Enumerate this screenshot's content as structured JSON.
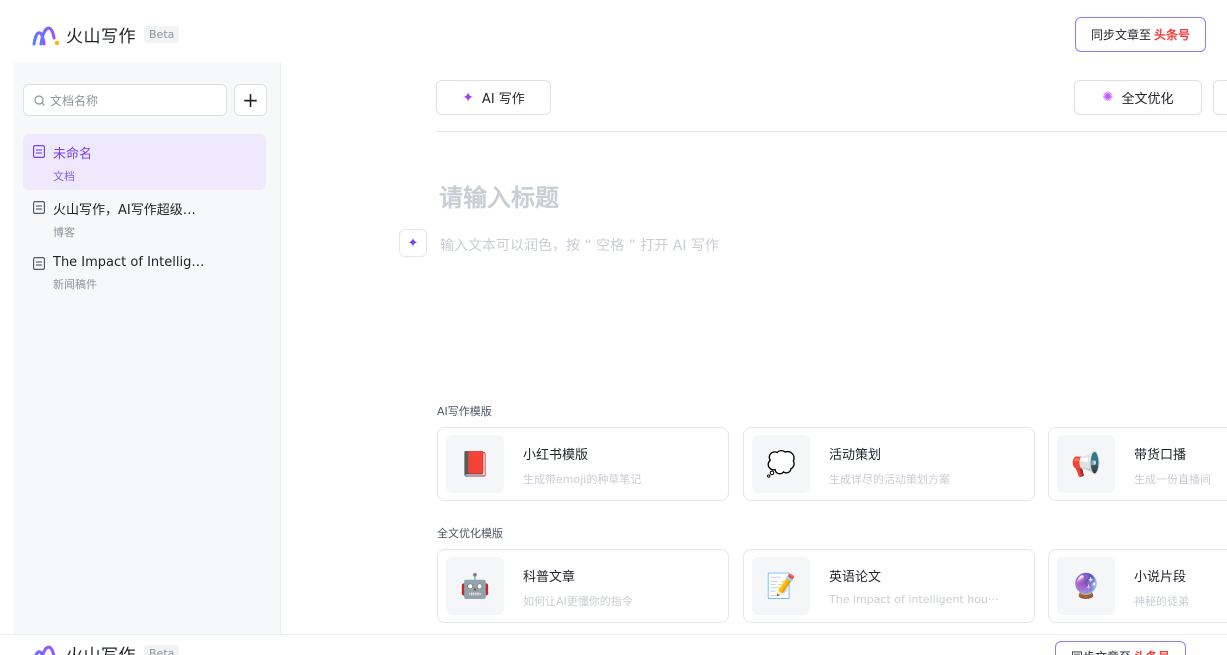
{
  "header": {
    "logo_text": "火山写作",
    "beta": "Beta",
    "sync_label": "同步文章至",
    "sync_target": "头条号"
  },
  "sidebar": {
    "search_placeholder": "文档名称",
    "add_label": "+",
    "docs": [
      {
        "title": "未命名",
        "type": "文档",
        "active": true
      },
      {
        "title": "火山写作，AI写作超级…",
        "type": "博客",
        "active": false
      },
      {
        "title": "The Impact of Intellig…",
        "type": "新闻稿件",
        "active": false
      }
    ]
  },
  "editor": {
    "ai_write_label": "AI 写作",
    "optimize_label": "全文优化",
    "title_placeholder": "请输入标题",
    "body_placeholder": "输入文本可以润色，按 “ 空格 ” 打开 AI 写作"
  },
  "templates": {
    "ai_section_label": "AI写作模版",
    "ai_cards": [
      {
        "icon": "📕",
        "icon_name": "red-book-icon",
        "title": "小红书模版",
        "desc": "生成带emoji的种草笔记"
      },
      {
        "icon": "💭",
        "icon_name": "speech-bubble-icon",
        "title": "活动策划",
        "desc": "生成详尽的活动策划方案"
      },
      {
        "icon": "📢",
        "icon_name": "megaphone-icon",
        "title": "带货口播",
        "desc": "生成一份直播间"
      }
    ],
    "opt_section_label": "全文优化模版",
    "opt_cards": [
      {
        "icon": "🤖",
        "icon_name": "robot-icon",
        "title": "科普文章",
        "desc": "如何让AI更懂你的指令"
      },
      {
        "icon": "📝",
        "icon_name": "memo-icon",
        "title": "英语论文",
        "desc": "The impact of intelligent hou···"
      },
      {
        "icon": "🔮",
        "icon_name": "crystal-ball-icon",
        "title": "小说片段",
        "desc": "神秘的徒弟"
      }
    ]
  },
  "colors": {
    "accent": "#7b3ff2",
    "active_bg": "#efe9fd",
    "sync_border": "#8a7bff",
    "sync_target": "#f53f3f"
  }
}
